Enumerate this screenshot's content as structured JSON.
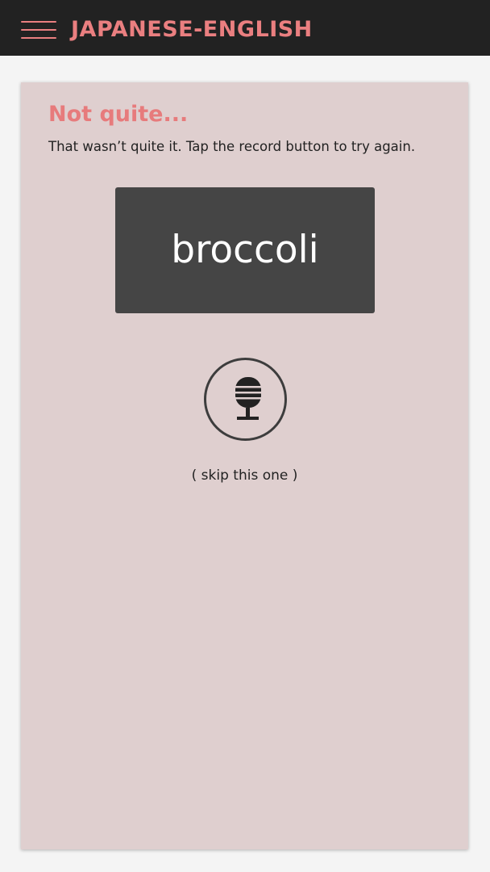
{
  "header": {
    "menu_icon": "hamburger-menu-icon",
    "title": "JAPANESE-ENGLISH"
  },
  "card": {
    "status_title": "Not quite...",
    "status_message": "That wasn’t quite it. Tap the record button to try again.",
    "word": "broccoli",
    "record_icon": "microphone-icon",
    "skip_label": "( skip this one )"
  },
  "colors": {
    "topbar_bg": "#222222",
    "accent": "#ea7f80",
    "card_bg": "#dfcfcf",
    "word_box_bg": "#454545",
    "page_bg": "#f4f4f4"
  }
}
